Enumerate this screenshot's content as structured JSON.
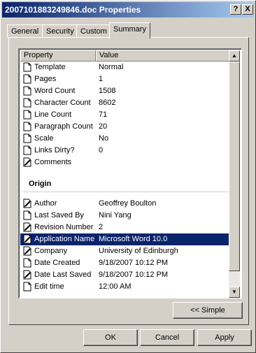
{
  "window": {
    "title": "2007101883249846.doc Properties",
    "help_label": "?",
    "close_label": "X"
  },
  "tabs": [
    {
      "label": "General"
    },
    {
      "label": "Security"
    },
    {
      "label": "Custom"
    },
    {
      "label": "Summary",
      "active": true
    }
  ],
  "list": {
    "columns": {
      "property": "Property",
      "value": "Value"
    },
    "rows": [
      {
        "name": "Template",
        "value": "Normal",
        "icon": "page-icon"
      },
      {
        "name": "Pages",
        "value": "1",
        "icon": "page-icon"
      },
      {
        "name": "Word Count",
        "value": "1508",
        "icon": "page-icon"
      },
      {
        "name": "Character Count",
        "value": "8602",
        "icon": "page-icon"
      },
      {
        "name": "Line Count",
        "value": "71",
        "icon": "page-icon"
      },
      {
        "name": "Paragraph Count",
        "value": "20",
        "icon": "page-icon"
      },
      {
        "name": "Scale",
        "value": "No",
        "icon": "page-icon"
      },
      {
        "name": "Links Dirty?",
        "value": "0",
        "icon": "page-icon"
      },
      {
        "name": "Comments",
        "value": "",
        "icon": "edit-page-icon"
      }
    ],
    "origin_label": "Origin",
    "origin_rows": [
      {
        "name": "Author",
        "value": "Geoffrey Boulton",
        "icon": "edit-page-icon"
      },
      {
        "name": "Last Saved By",
        "value": "Nini Yang",
        "icon": "page-icon"
      },
      {
        "name": "Revision Number",
        "value": "2",
        "icon": "edit-page-icon"
      },
      {
        "name": "Application Name",
        "value": "Microsoft Word 10.0",
        "icon": "edit-page-icon",
        "selected": true
      },
      {
        "name": "Company",
        "value": "University of Edinburgh",
        "icon": "edit-page-icon"
      },
      {
        "name": "Date Created",
        "value": "9/18/2007 10:12 PM",
        "icon": "page-icon"
      },
      {
        "name": "Date Last Saved",
        "value": "9/18/2007 10:12 PM",
        "icon": "edit-page-icon"
      },
      {
        "name": "Edit time",
        "value": " 12:00 AM",
        "icon": "page-icon"
      }
    ]
  },
  "buttons": {
    "simple": "<< Simple",
    "ok": "OK",
    "cancel": "Cancel",
    "apply": "Apply"
  },
  "colors": {
    "selection": "#0a246a",
    "face": "#d4d0c8"
  }
}
